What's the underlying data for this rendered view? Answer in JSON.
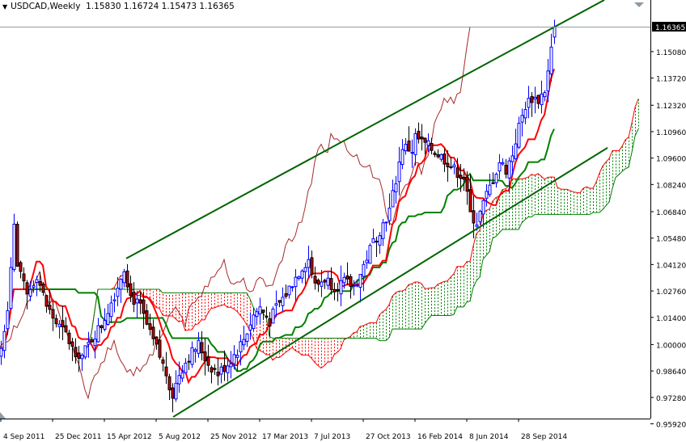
{
  "header": {
    "symbol_timeframe": "USDCAD,Weekly",
    "ohlc": "1.15830 1.16724 1.15473 1.16365"
  },
  "chart_data": {
    "type": "candlestick",
    "title": "USDCAD,Weekly",
    "timeframe": "Weekly",
    "last_bar": {
      "open": 1.1583,
      "high": 1.16724,
      "low": 1.15473,
      "close": 1.16365
    },
    "current_price_label": "1.16365",
    "ylim": [
      0.956,
      1.1775
    ],
    "y_ticks": [
      "1.15080",
      "1.13720",
      "1.12320",
      "1.10960",
      "1.09600",
      "1.08240",
      "1.06840",
      "1.05480",
      "1.04120",
      "1.02760",
      "1.01400",
      "1.00000",
      "0.98640",
      "0.97280",
      "0.95920"
    ],
    "x_ticks": [
      {
        "week": 0,
        "label": "4 Sep 2011"
      },
      {
        "week": 16,
        "label": "25 Dec 2011"
      },
      {
        "week": 32,
        "label": "15 Apr 2012"
      },
      {
        "week": 48,
        "label": "5 Aug 2012"
      },
      {
        "week": 64,
        "label": "25 Nov 2012"
      },
      {
        "week": 80,
        "label": "17 Mar 2013"
      },
      {
        "week": 96,
        "label": "7 Jul 2013"
      },
      {
        "week": 112,
        "label": "27 Oct 2013"
      },
      {
        "week": 128,
        "label": "16 Feb 2014"
      },
      {
        "week": 144,
        "label": "8 Jun 2014"
      },
      {
        "week": 160,
        "label": "28 Sep 2014"
      }
    ],
    "weekly_close_keypoints": [
      [
        0,
        0.998
      ],
      [
        2,
        1.02
      ],
      [
        4,
        1.062
      ],
      [
        5,
        1.04
      ],
      [
        8,
        1.025
      ],
      [
        11,
        1.036
      ],
      [
        14,
        1.02
      ],
      [
        17,
        1.011
      ],
      [
        20,
        1.005
      ],
      [
        22,
        0.998
      ],
      [
        25,
        0.994
      ],
      [
        28,
        1.003
      ],
      [
        31,
        1.01
      ],
      [
        36,
        1.03
      ],
      [
        38,
        1.04
      ],
      [
        40,
        1.025
      ],
      [
        43,
        1.019
      ],
      [
        46,
        1.005
      ],
      [
        48,
        0.998
      ],
      [
        51,
        0.985
      ],
      [
        53,
        0.974
      ],
      [
        55,
        0.985
      ],
      [
        58,
        0.994
      ],
      [
        61,
        1.0
      ],
      [
        64,
        0.99
      ],
      [
        67,
        0.985
      ],
      [
        70,
        0.99
      ],
      [
        73,
        0.997
      ],
      [
        75,
        1.003
      ],
      [
        78,
        1.015
      ],
      [
        80,
        1.019
      ],
      [
        83,
        1.012
      ],
      [
        85,
        1.019
      ],
      [
        88,
        1.026
      ],
      [
        90,
        1.032
      ],
      [
        93,
        1.04
      ],
      [
        95,
        1.044
      ],
      [
        97,
        1.03
      ],
      [
        100,
        1.034
      ],
      [
        103,
        1.03
      ],
      [
        106,
        1.032
      ],
      [
        109,
        1.03
      ],
      [
        111,
        1.036
      ],
      [
        113,
        1.045
      ],
      [
        115,
        1.053
      ],
      [
        118,
        1.062
      ],
      [
        120,
        1.069
      ],
      [
        122,
        1.085
      ],
      [
        124,
        1.102
      ],
      [
        127,
        1.1
      ],
      [
        128,
        1.107
      ],
      [
        130,
        1.104
      ],
      [
        132,
        1.102
      ],
      [
        135,
        1.098
      ],
      [
        138,
        1.094
      ],
      [
        140,
        1.09
      ],
      [
        143,
        1.086
      ],
      [
        145,
        1.067
      ],
      [
        147,
        1.063
      ],
      [
        150,
        1.077
      ],
      [
        152,
        1.085
      ],
      [
        154,
        1.094
      ],
      [
        156,
        1.09
      ],
      [
        158,
        1.098
      ],
      [
        160,
        1.112
      ],
      [
        162,
        1.123
      ],
      [
        164,
        1.127
      ],
      [
        166,
        1.126
      ],
      [
        168,
        1.131
      ],
      [
        169,
        1.14
      ],
      [
        170,
        1.152
      ],
      [
        171,
        1.16365
      ]
    ],
    "indicators": {
      "ichimoku": {
        "tenkan": 9,
        "kijun": 26,
        "senkou_b": 52,
        "tenkan_color": "#ff0000",
        "kijun_color": "#008000",
        "chikou_color": "#a52a2a",
        "cloud_up_color": "#008000",
        "cloud_down_color": "#ff0000"
      }
    },
    "trendlines": [
      {
        "name": "upper-channel",
        "from": {
          "week": 38.75,
          "price": 1.0443
        },
        "to": {
          "week": 186.5,
          "price": 1.1774
        },
        "color": "#006400"
      },
      {
        "name": "lower-channel",
        "from": {
          "week": 53.25,
          "price": 0.9627
        },
        "to": {
          "week": 187.5,
          "price": 1.1013
        },
        "color": "#006400"
      }
    ],
    "colors": {
      "bull": "#0000ff",
      "bear": "#000000",
      "bear_body": "#cc0000",
      "price_line": "#8c9aa8",
      "axis": "#000000"
    }
  }
}
